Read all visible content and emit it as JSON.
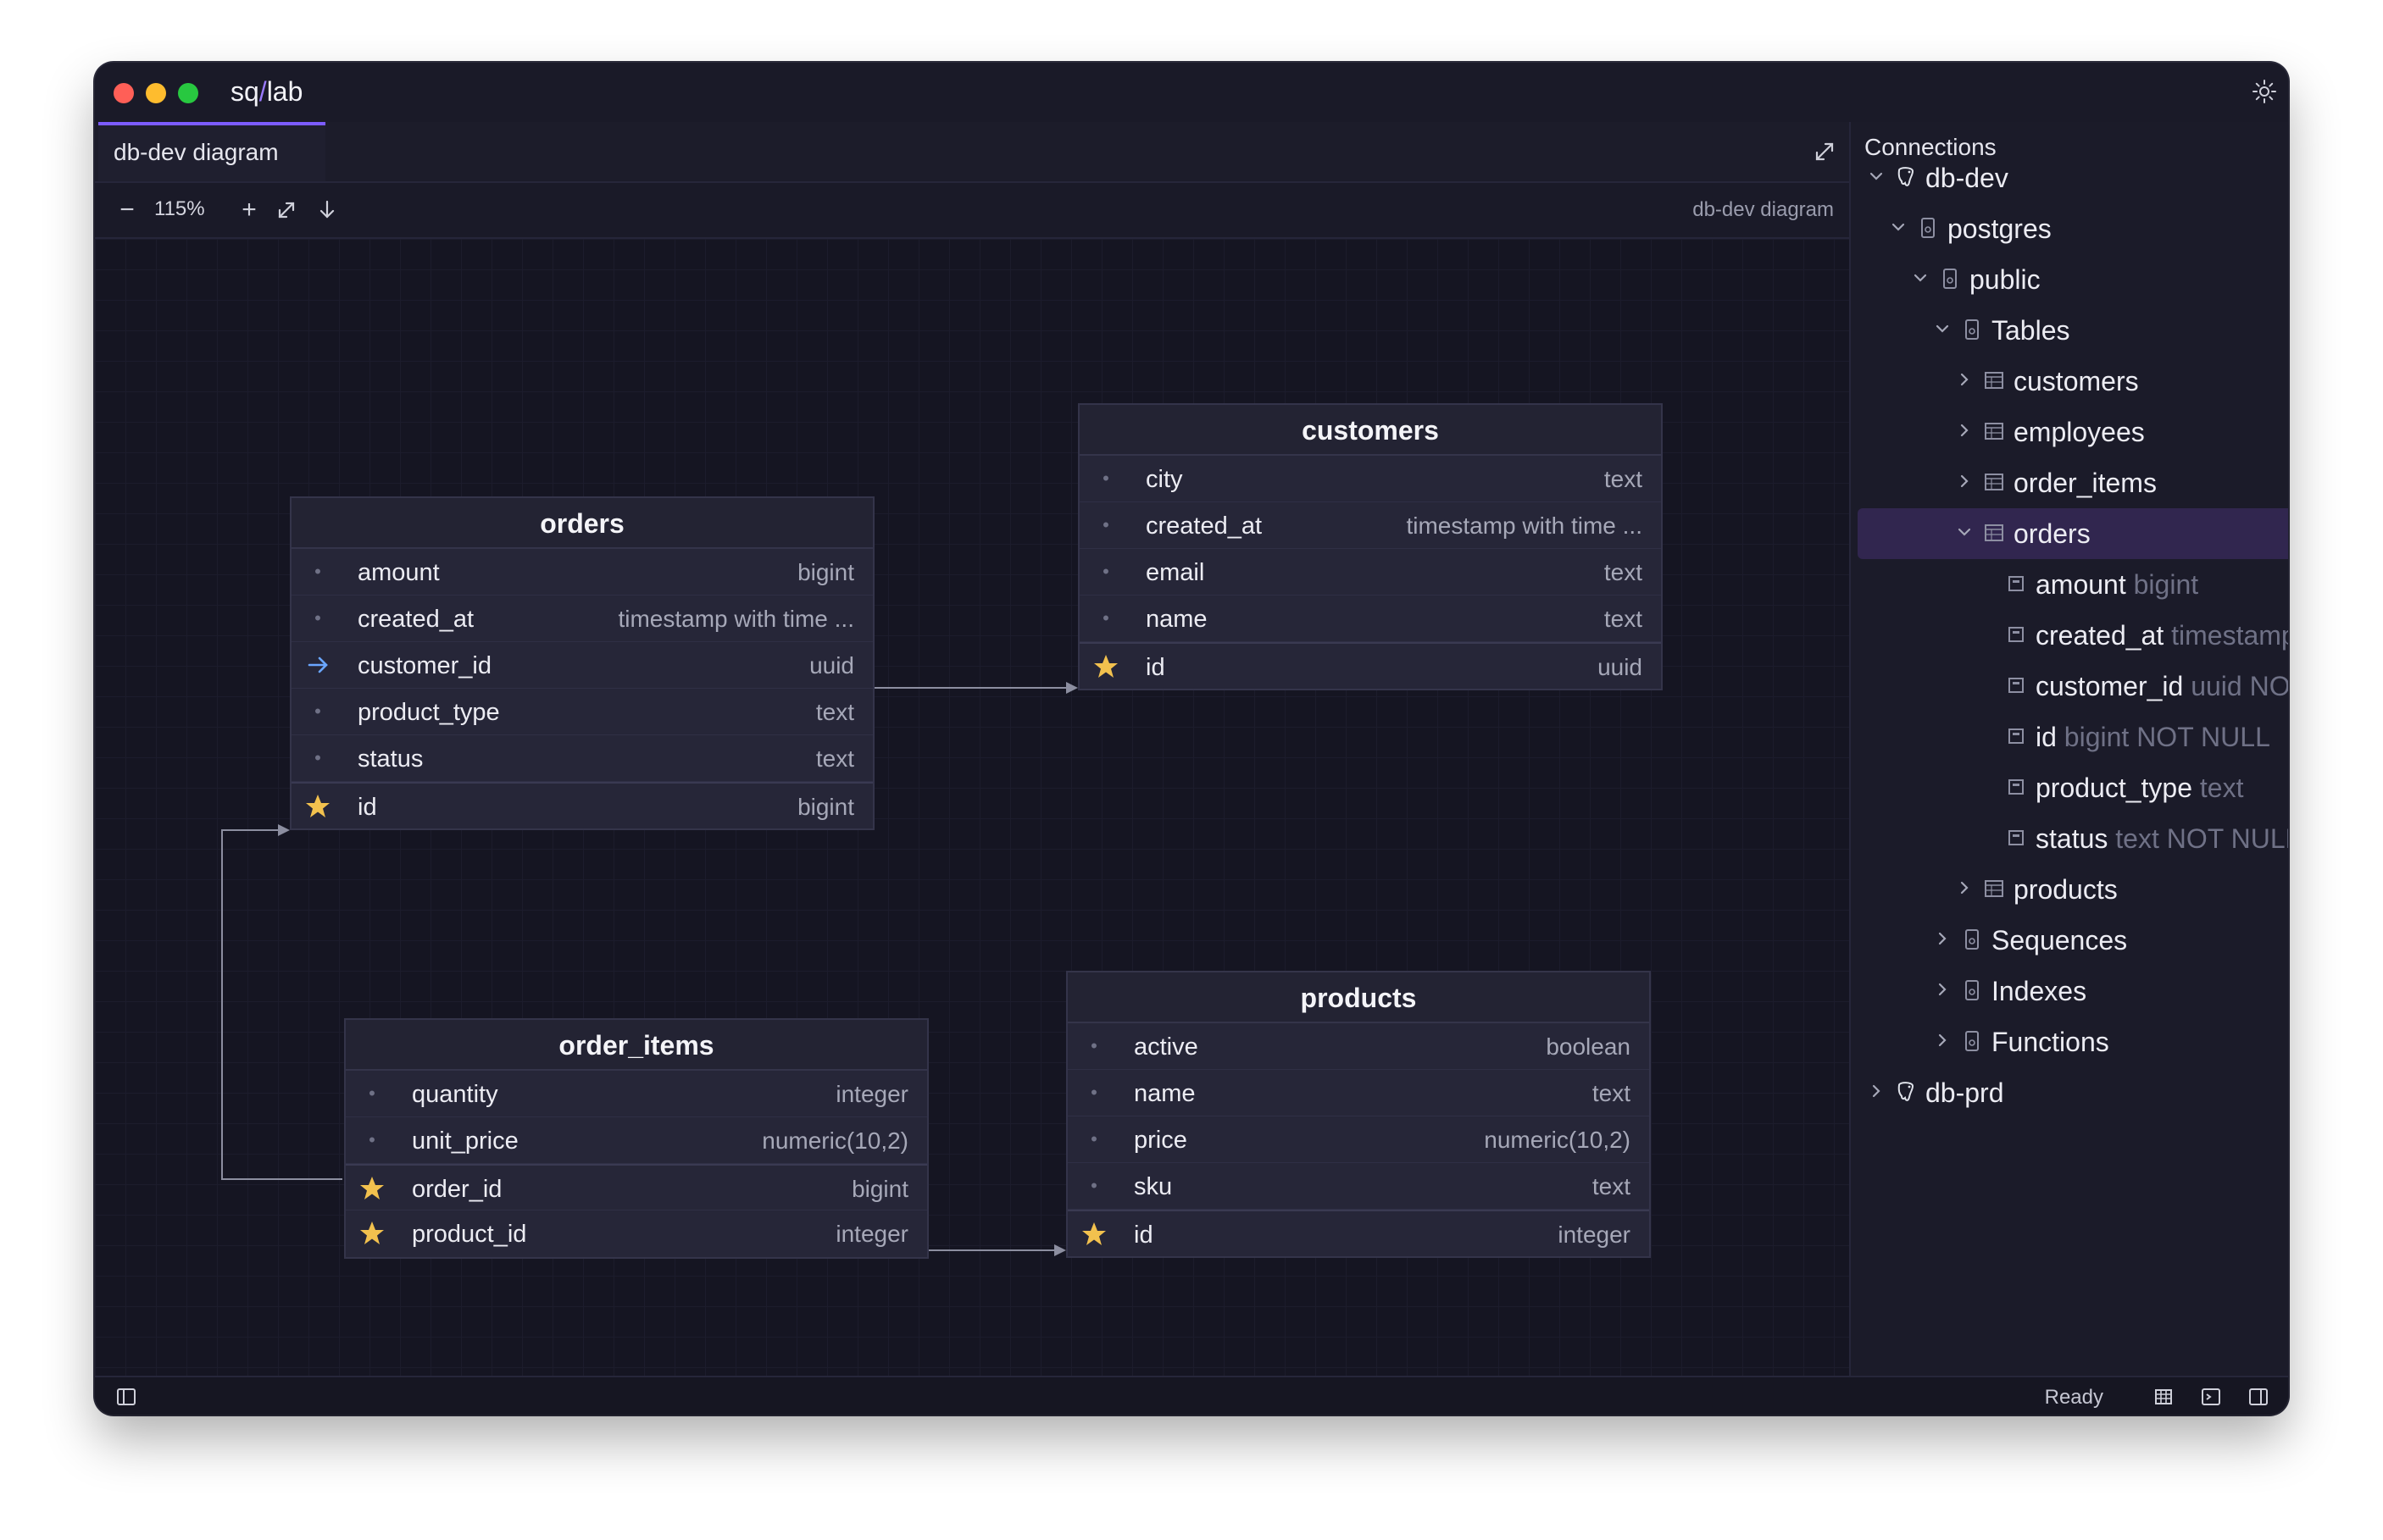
{
  "app": {
    "title_prefix": "sq",
    "title_slash": "/",
    "title_suffix": "lab"
  },
  "tab": {
    "label": "db-dev diagram"
  },
  "toolbar": {
    "zoom_out": "−",
    "zoom": "115%",
    "zoom_in": "+",
    "breadcrumb": "db-dev diagram"
  },
  "tables": {
    "orders": {
      "title": "orders",
      "columns": [
        {
          "name": "amount",
          "type": "bigint",
          "mark": "dot"
        },
        {
          "name": "created_at",
          "type": "timestamp with time ...",
          "mark": "dot"
        },
        {
          "name": "customer_id",
          "type": "uuid",
          "mark": "fk"
        },
        {
          "name": "product_type",
          "type": "text",
          "mark": "dot"
        },
        {
          "name": "status",
          "type": "text",
          "mark": "dot"
        },
        {
          "name": "id",
          "type": "bigint",
          "mark": "pk"
        }
      ]
    },
    "customers": {
      "title": "customers",
      "columns": [
        {
          "name": "city",
          "type": "text",
          "mark": "dot"
        },
        {
          "name": "created_at",
          "type": "timestamp with time ...",
          "mark": "dot"
        },
        {
          "name": "email",
          "type": "text",
          "mark": "dot"
        },
        {
          "name": "name",
          "type": "text",
          "mark": "dot"
        },
        {
          "name": "id",
          "type": "uuid",
          "mark": "pk"
        }
      ]
    },
    "order_items": {
      "title": "order_items",
      "columns": [
        {
          "name": "quantity",
          "type": "integer",
          "mark": "dot"
        },
        {
          "name": "unit_price",
          "type": "numeric(10,2)",
          "mark": "dot"
        },
        {
          "name": "order_id",
          "type": "bigint",
          "mark": "pk"
        },
        {
          "name": "product_id",
          "type": "integer",
          "mark": "pk"
        }
      ]
    },
    "products": {
      "title": "products",
      "columns": [
        {
          "name": "active",
          "type": "boolean",
          "mark": "dot"
        },
        {
          "name": "name",
          "type": "text",
          "mark": "dot"
        },
        {
          "name": "price",
          "type": "numeric(10,2)",
          "mark": "dot"
        },
        {
          "name": "sku",
          "type": "text",
          "mark": "dot"
        },
        {
          "name": "id",
          "type": "integer",
          "mark": "pk"
        }
      ]
    }
  },
  "sidebar": {
    "title": "Connections",
    "nodes": [
      {
        "label": "db-dev",
        "extra": "",
        "icon": "postgres-elephant-icon",
        "chevron": "down",
        "level": 0
      },
      {
        "label": "postgres",
        "extra": "",
        "icon": "database-icon",
        "chevron": "down",
        "level": 1
      },
      {
        "label": "public",
        "extra": "",
        "icon": "schema-icon",
        "chevron": "down",
        "level": 2
      },
      {
        "label": "Tables",
        "extra": "",
        "icon": "folder-icon",
        "chevron": "down",
        "level": 3
      },
      {
        "label": "customers",
        "extra": "",
        "icon": "table-icon",
        "chevron": "right",
        "level": 4
      },
      {
        "label": "employees",
        "extra": "",
        "icon": "table-icon",
        "chevron": "right",
        "level": 4
      },
      {
        "label": "order_items",
        "extra": "",
        "icon": "table-icon",
        "chevron": "right",
        "level": 4
      },
      {
        "label": "orders",
        "extra": "",
        "icon": "table-icon",
        "chevron": "down",
        "level": 4,
        "selected": true
      },
      {
        "label": "amount",
        "extra": "bigint",
        "icon": "column-icon",
        "chevron": "",
        "level": 5
      },
      {
        "label": "created_at",
        "extra": "timestamp",
        "icon": "column-icon",
        "chevron": "",
        "level": 5
      },
      {
        "label": "customer_id",
        "extra": "uuid NO",
        "icon": "column-icon",
        "chevron": "",
        "level": 5
      },
      {
        "label": "id",
        "extra": "bigint NOT NULL",
        "icon": "column-icon",
        "chevron": "",
        "level": 5
      },
      {
        "label": "product_type",
        "extra": "text",
        "icon": "column-icon",
        "chevron": "",
        "level": 5
      },
      {
        "label": "status",
        "extra": "text NOT NULL",
        "icon": "column-icon",
        "chevron": "",
        "level": 5
      },
      {
        "label": "products",
        "extra": "",
        "icon": "table-icon",
        "chevron": "right",
        "level": 4
      },
      {
        "label": "Sequences",
        "extra": "",
        "icon": "folder-icon",
        "chevron": "right",
        "level": 3
      },
      {
        "label": "Indexes",
        "extra": "",
        "icon": "folder-icon",
        "chevron": "right",
        "level": 3
      },
      {
        "label": "Functions",
        "extra": "",
        "icon": "folder-icon",
        "chevron": "right",
        "level": 3
      },
      {
        "label": "db-prd",
        "extra": "",
        "icon": "postgres-elephant-icon",
        "chevron": "right",
        "level": 0
      }
    ]
  },
  "status": {
    "text": "Ready"
  },
  "colors": {
    "accent": "#7c5cff",
    "pk_star": "#f2c14e",
    "fk_arrow": "#6aa6ff",
    "selected": "#31264f"
  }
}
